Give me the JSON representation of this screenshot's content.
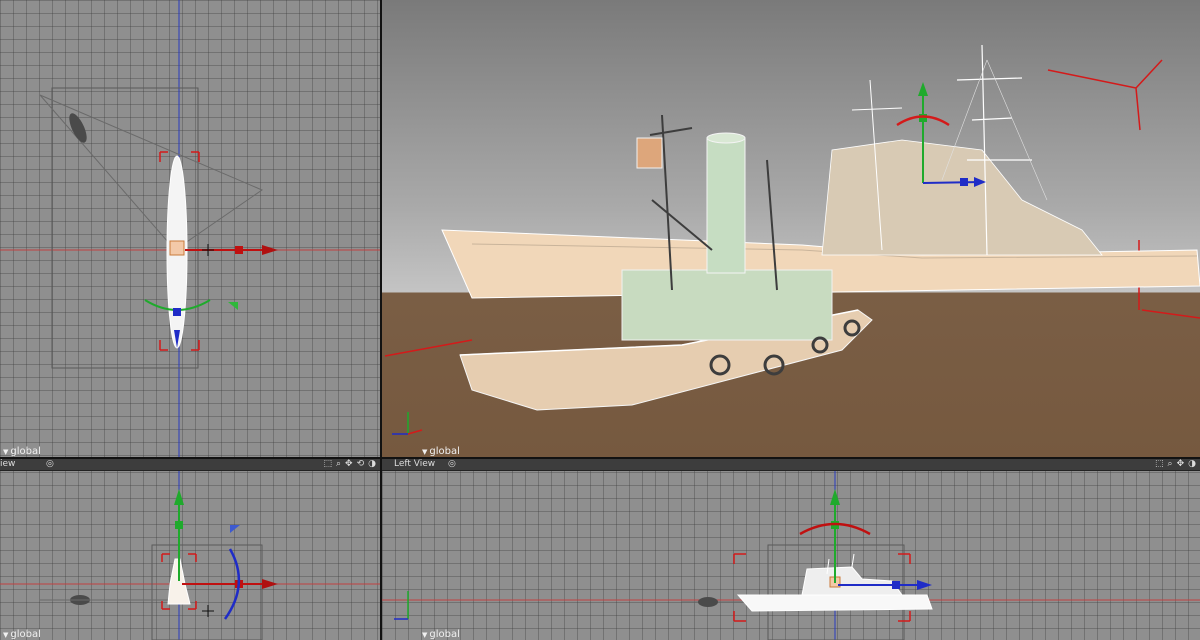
{
  "viewports": {
    "top": {
      "coord_label": "global"
    },
    "perspective": {
      "coord_label": "global"
    },
    "front": {
      "name": "iew",
      "coord_label": "global"
    },
    "left": {
      "name": "Left View",
      "coord_label": "global"
    }
  },
  "icons": [
    "camera-eye-icon",
    "zoom-region-icon",
    "zoom-icon",
    "pan-icon",
    "orbit-icon",
    "maximize-icon"
  ],
  "colors": {
    "axis_red": "#d41a1a",
    "axis_green": "#1faa2c",
    "axis_blue": "#1f2cc7",
    "ground": "#76593f",
    "grid": "#8f8f8f"
  }
}
